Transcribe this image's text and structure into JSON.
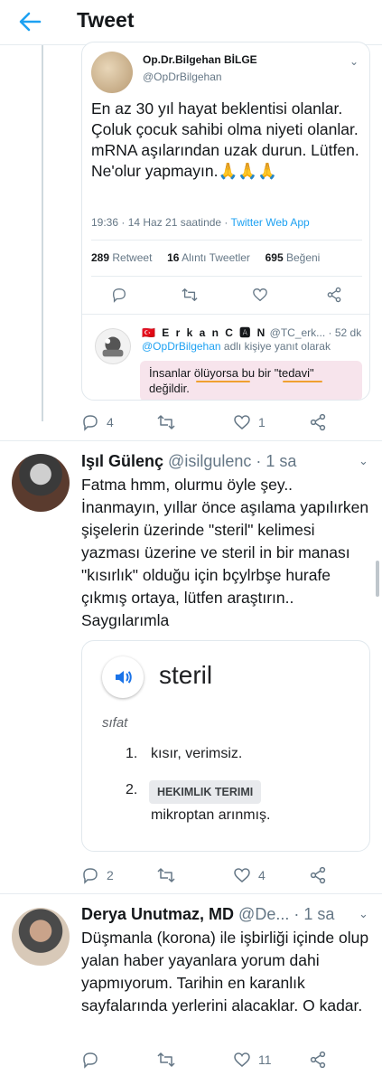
{
  "header": {
    "title": "Tweet"
  },
  "quoted_tweet": {
    "name": "Op.Dr.Bilgehan BİLGE",
    "handle": "@OpDrBilgehan",
    "text": "En az 30 yıl hayat beklentisi olanlar. Çoluk çocuk sahibi olma niyeti olanlar. mRNA aşılarından uzak durun. Lütfen. Ne'olur yapmayın.🙏🙏🙏",
    "time": "19:36 · 14 Haz 21 saatinde · ",
    "source": "Twitter Web App",
    "retweets": "289",
    "retweets_label": "Retweet",
    "quotes": "16",
    "quotes_label": "Alıntı Tweetler",
    "likes": "695",
    "likes_label": "Beğeni",
    "reply": {
      "name": "🇹🇷 E r k a n C 🅰 N",
      "handle_time": "@TC_erk... · 52 dk",
      "mention": "@OpDrBilgehan",
      "reply_suffix": " adlı kişiye yanıt olarak",
      "text_line1": "İnsanlar ölüyorsa bu bir \"tedavi\"",
      "text_line2": "değildir."
    }
  },
  "tweet1_actions": {
    "replies": "4",
    "likes": "1"
  },
  "tweet2": {
    "name": "Işıl Gülenç",
    "handle_time": "@isilgulenc · 1 sa",
    "text": "Fatma hmm, olurmu öyle şey.. İnanmayın, yıllar önce aşılama yapılırken şişelerin üzerinde \"steril\" kelimesi yazması üzerine ve steril in bir manası \"kısırlık\" olduğu için bçylrbşe hurafe çıkmış ortaya, lütfen araştırın.. Saygılarımla",
    "card": {
      "word": "steril",
      "pos": "sıfat",
      "def1_num": "1.",
      "def1_text": "kısır, verimsiz.",
      "def2_num": "2.",
      "def2_tag": "HEKIMLIK TERIMI",
      "def2_text": "mikroptan arınmış."
    },
    "actions": {
      "replies": "2",
      "likes": "4"
    }
  },
  "tweet3": {
    "name": "Derya Unutmaz, MD",
    "handle_time": "@De... · 1 sa",
    "text": "Düşmanla (korona) ile işbirliği içinde olup yalan haber yayanlara yorum dahi yapmıyorum. Tarihin en karanlık sayfalarında yerlerini alacaklar. O kadar.",
    "actions": {
      "likes": "11"
    }
  },
  "colors": {
    "accent": "#1da1f2",
    "muted": "#657786",
    "highlight": "#f7e4ec",
    "underline": "#f0a030"
  },
  "icons": [
    "back-arrow-icon",
    "reply-icon",
    "retweet-icon",
    "like-icon",
    "share-icon",
    "chevron-down-icon",
    "speaker-icon"
  ]
}
